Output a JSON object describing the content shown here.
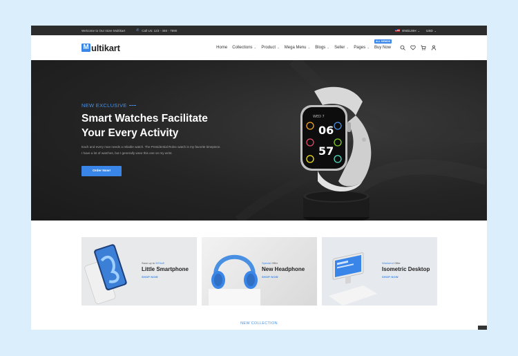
{
  "topbar": {
    "welcome": "Welcome to Our store Multikart",
    "call": "Call Us: 123 - 456 - 7890",
    "language": "ENGLISH",
    "currency": "USD"
  },
  "header": {
    "logo_mark": "M",
    "logo_text": "ultikart",
    "nav": [
      {
        "label": "Home",
        "chevron": false
      },
      {
        "label": "Collections",
        "chevron": true
      },
      {
        "label": "Product",
        "chevron": true
      },
      {
        "label": "Mega Menu",
        "chevron": true
      },
      {
        "label": "Blogs",
        "chevron": true
      },
      {
        "label": "Seller",
        "chevron": true
      },
      {
        "label": "Pages",
        "chevron": true
      },
      {
        "label": "Buy Now",
        "chevron": false,
        "badge": "ALL DEMOS"
      }
    ]
  },
  "hero": {
    "kicker": "NEW EXCLUSIVE",
    "title_line1": "Smart Watches Facilitate",
    "title_line2": "Your Every Activity",
    "desc_line1": "Each and every man needs a reliable watch. The Presidential Rolex watch is my favorite timepiece.",
    "desc_line2": "I have a lot of watches, but I generally wear this one on my wrist.",
    "cta": "Order Now!"
  },
  "banners": [
    {
      "eyebrow_prefix": "Save up to ",
      "eyebrow_accent": "50%off",
      "eyebrow_suffix": "",
      "title": "Little Smartphone",
      "cta": "SHOP NOW"
    },
    {
      "eyebrow_prefix": "",
      "eyebrow_accent": "Special",
      "eyebrow_suffix": " Offer",
      "title": "New Headphone",
      "cta": "SHOP NOW"
    },
    {
      "eyebrow_prefix": "",
      "eyebrow_accent": "Weekend",
      "eyebrow_suffix": " Offer",
      "title": "Isometric Desktop",
      "cta": "SHOP NOW"
    }
  ],
  "section_heading": "NEW COLLECTION",
  "watch_face": {
    "time_top": "06",
    "time_bottom": "57"
  },
  "colors": {
    "accent": "#3a86e8",
    "dark": "#242424"
  }
}
